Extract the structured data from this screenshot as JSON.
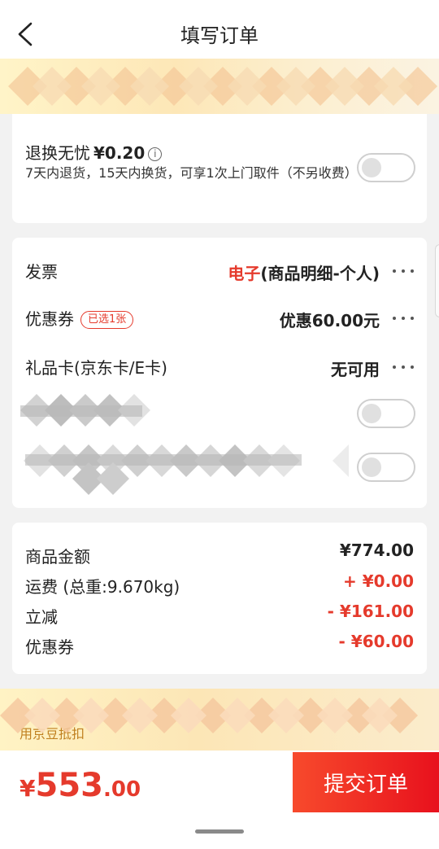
{
  "header": {
    "title": "填写订单",
    "back_icon": "chevron-left-icon"
  },
  "service": {
    "name": "退换无忧",
    "price": "¥0.20",
    "info_icon": "i",
    "description": "7天内退货，15天内换货，可享1次上门取件（不另收费）",
    "enabled": false
  },
  "options": {
    "invoice": {
      "label": "发票",
      "value_prefix": "电子",
      "value_rest": "(商品明细-个人)"
    },
    "coupon": {
      "label": "优惠券",
      "badge": "已选1张",
      "value": "优惠60.00元"
    },
    "giftcard": {
      "label": "礼品卡(京东卡/E卡)",
      "value": "无可用"
    },
    "toggle_a": false,
    "toggle_b": false
  },
  "summary": {
    "rows": [
      {
        "label": "商品金额",
        "value": "¥774.00"
      },
      {
        "label": "运费 (总重:9.670kg)",
        "value": "+ ¥0.00"
      },
      {
        "label": "立减",
        "value": "- ¥161.00"
      },
      {
        "label": "优惠券",
        "value": "- ¥60.00"
      }
    ]
  },
  "promo": {
    "text": "用京豆抵扣"
  },
  "footer": {
    "currency": "¥",
    "total_int": "553",
    "total_dec": ".00",
    "submit_label": "提交订单"
  },
  "colors": {
    "accent": "#e53a2c",
    "button": "#e8111d",
    "promo_bg": "#fde7b7"
  }
}
